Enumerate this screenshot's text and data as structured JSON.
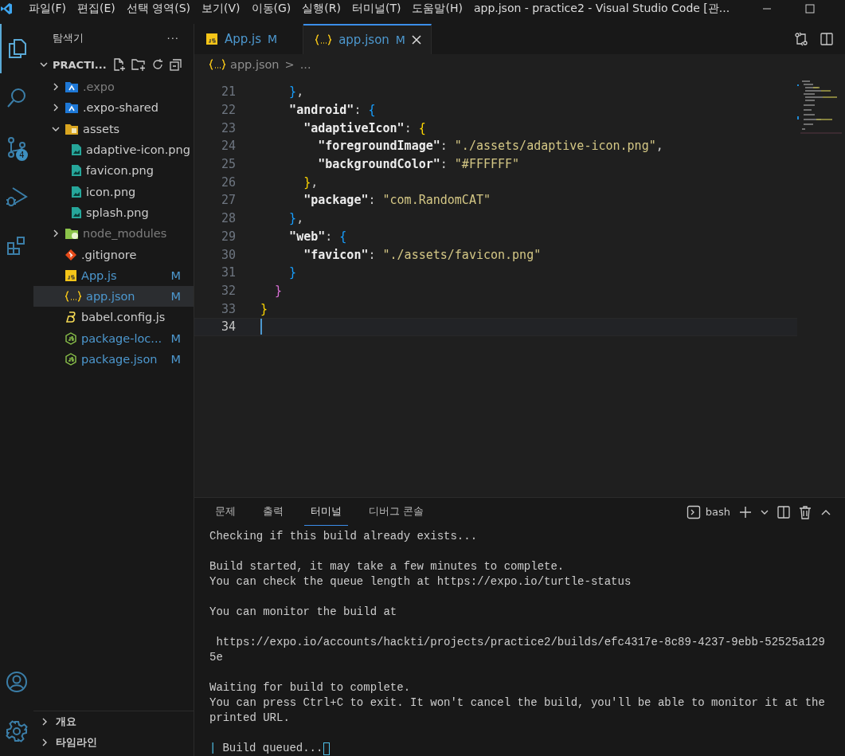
{
  "menu": [
    "파일(F)",
    "편집(E)",
    "선택 영역(S)",
    "보기(V)",
    "이동(G)",
    "실행(R)",
    "터미널(T)",
    "도움말(H)"
  ],
  "window": {
    "title": "app.json - practice2 - Visual Studio Code [관..."
  },
  "activity_bar": [
    {
      "kind": "files",
      "selected": true
    },
    {
      "kind": "search",
      "selected": false
    },
    {
      "kind": "source-control",
      "selected": false,
      "badge": "4"
    },
    {
      "kind": "debug",
      "selected": false
    },
    {
      "kind": "extensions",
      "selected": false
    }
  ],
  "sidebar": {
    "title": "탐색기",
    "more": "···",
    "project": {
      "label": "PRACTI...",
      "expanded": true
    },
    "items": [
      {
        "name": ".expo",
        "kind": "expo-folder",
        "expanded": false,
        "dimmed": true,
        "selected": false
      },
      {
        "name": ".expo-shared",
        "kind": "expo-folder",
        "expanded": false,
        "dimmed": false,
        "selected": false
      },
      {
        "name": "assets",
        "kind": "folder",
        "expanded": true,
        "dimmed": false,
        "selected": false,
        "children": [
          {
            "name": "adaptive-icon.png",
            "kind": "image",
            "dimmed": false,
            "selected": false
          },
          {
            "name": "favicon.png",
            "kind": "image",
            "dimmed": false,
            "selected": false
          },
          {
            "name": "icon.png",
            "kind": "image",
            "dimmed": false,
            "selected": false
          },
          {
            "name": "splash.png",
            "kind": "image",
            "dimmed": false,
            "selected": false
          }
        ]
      },
      {
        "name": "node_modules",
        "kind": "node-folder",
        "expanded": false,
        "dimmed": true,
        "selected": false
      },
      {
        "name": ".gitignore",
        "kind": "git",
        "dimmed": false,
        "selected": false
      },
      {
        "name": "App.js",
        "kind": "js",
        "status": "M",
        "dimmed": false,
        "selected": false
      },
      {
        "name": "app.json",
        "kind": "json",
        "status": "M",
        "dimmed": false,
        "selected": true
      },
      {
        "name": "babel.config.js",
        "kind": "babel",
        "dimmed": false,
        "selected": false
      },
      {
        "name": "package-loc...",
        "kind": "node",
        "status": "M",
        "dimmed": false,
        "selected": false
      },
      {
        "name": "package.json",
        "kind": "node",
        "status": "M",
        "dimmed": false,
        "selected": false
      }
    ],
    "sections": [
      {
        "label": "개요",
        "expanded": false
      },
      {
        "label": "타임라인",
        "expanded": false
      }
    ]
  },
  "tabs": [
    {
      "label": "App.js",
      "kind": "js",
      "status": "M",
      "selected": false
    },
    {
      "label": "app.json",
      "kind": "json",
      "status": "M",
      "selected": true
    }
  ],
  "breadcrumb": {
    "file": "app.json",
    "separator": ">",
    "more": "..."
  },
  "editor": {
    "lines": [
      {
        "number": "21",
        "tokens": [
          {
            "kind": "brace",
            "t": "    }",
            "color": "#179fff"
          },
          {
            "kind": "plain",
            "t": ","
          }
        ]
      },
      {
        "number": "22",
        "tokens": [
          {
            "kind": "key",
            "t": "    \"android\""
          },
          {
            "kind": "plain",
            "t": ": "
          },
          {
            "kind": "brace",
            "t": "{",
            "color": "#179fff"
          }
        ]
      },
      {
        "number": "23",
        "tokens": [
          {
            "kind": "key",
            "t": "      \"adaptiveIcon\""
          },
          {
            "kind": "plain",
            "t": ": "
          },
          {
            "kind": "brace",
            "t": "{",
            "color": "#ffd700"
          }
        ]
      },
      {
        "number": "24",
        "tokens": [
          {
            "kind": "key",
            "t": "        \"foregroundImage\""
          },
          {
            "kind": "plain",
            "t": ": "
          },
          {
            "kind": "str",
            "t": "\"./assets/adaptive-icon.png\""
          },
          {
            "kind": "plain",
            "t": ","
          }
        ]
      },
      {
        "number": "25",
        "tokens": [
          {
            "kind": "key",
            "t": "        \"backgroundColor\""
          },
          {
            "kind": "plain",
            "t": ": "
          },
          {
            "kind": "str",
            "t": "\"#FFFFFF\""
          }
        ]
      },
      {
        "number": "26",
        "tokens": [
          {
            "kind": "brace",
            "t": "      }",
            "color": "#ffd700"
          },
          {
            "kind": "plain",
            "t": ","
          }
        ]
      },
      {
        "number": "27",
        "tokens": [
          {
            "kind": "key",
            "t": "      \"package\""
          },
          {
            "kind": "plain",
            "t": ": "
          },
          {
            "kind": "str",
            "t": "\"com.RandomCAT\""
          }
        ]
      },
      {
        "number": "28",
        "tokens": [
          {
            "kind": "brace",
            "t": "    }",
            "color": "#179fff"
          },
          {
            "kind": "plain",
            "t": ","
          }
        ]
      },
      {
        "number": "29",
        "tokens": [
          {
            "kind": "key",
            "t": "    \"web\""
          },
          {
            "kind": "plain",
            "t": ": "
          },
          {
            "kind": "brace",
            "t": "{",
            "color": "#179fff"
          }
        ]
      },
      {
        "number": "30",
        "tokens": [
          {
            "kind": "key",
            "t": "      \"favicon\""
          },
          {
            "kind": "plain",
            "t": ": "
          },
          {
            "kind": "str",
            "t": "\"./assets/favicon.png\""
          }
        ]
      },
      {
        "number": "31",
        "tokens": [
          {
            "kind": "brace",
            "t": "    }",
            "color": "#179fff"
          }
        ]
      },
      {
        "number": "32",
        "tokens": [
          {
            "kind": "brace",
            "t": "  }",
            "color": "#da70d6"
          }
        ]
      },
      {
        "number": "33",
        "tokens": [
          {
            "kind": "brace",
            "t": "}",
            "color": "#ffd700"
          }
        ]
      },
      {
        "number": "34",
        "current": true
      }
    ]
  },
  "panel": {
    "tabs": [
      {
        "label": "문제",
        "selected": false
      },
      {
        "label": "출력",
        "selected": false
      },
      {
        "label": "터미널",
        "selected": true
      },
      {
        "label": "디버그 콘솔",
        "selected": false
      }
    ],
    "shell": "bash",
    "terminal": [
      [
        "Checking if this build already exists..."
      ],
      [
        "Build started, it may take a few minutes to complete.",
        "You can check the queue length at https://expo.io/turtle-status"
      ],
      [
        "You can monitor the build at"
      ],
      [
        " https://expo.io/accounts/hackti/projects/practice2/builds/efc4317e-8c89-4237-9ebb-52525a129",
        "5e"
      ],
      [
        "Waiting for build to complete.",
        "You can press Ctrl+C to exit. It won't cancel the build, you'll be able to monitor it at the",
        "printed URL."
      ]
    ],
    "status_line": {
      "marker": "|",
      "text": "Build queued..."
    }
  }
}
